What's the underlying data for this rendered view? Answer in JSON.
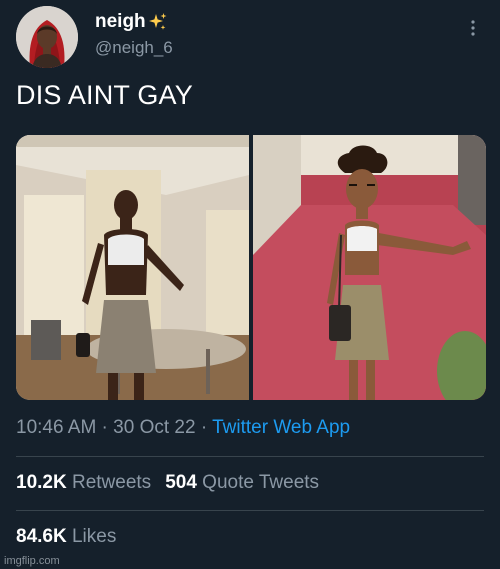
{
  "tweet": {
    "author": {
      "display_name": "neigh",
      "handle": "@neigh_6",
      "avatar_icon": "profile-avatar",
      "badge_icon": "sparkles-icon"
    },
    "text": "DIS AINT GAY",
    "timestamp": {
      "time": "10:46 AM",
      "separator_1": " · ",
      "date": "30 Oct 22",
      "separator_2": " · ",
      "source": "Twitter Web App"
    },
    "stats": {
      "retweets_count": "10.2K",
      "retweets_label": "Retweets",
      "quote_count": "504",
      "quote_label": "Quote Tweets",
      "likes_count": "84.6K",
      "likes_label": "Likes"
    }
  },
  "watermark": "imgflip.com",
  "colors": {
    "background": "#15202b",
    "text_primary": "#ffffff",
    "text_secondary": "#8b98a5",
    "link": "#1d9bf0",
    "divider": "#38444d"
  }
}
